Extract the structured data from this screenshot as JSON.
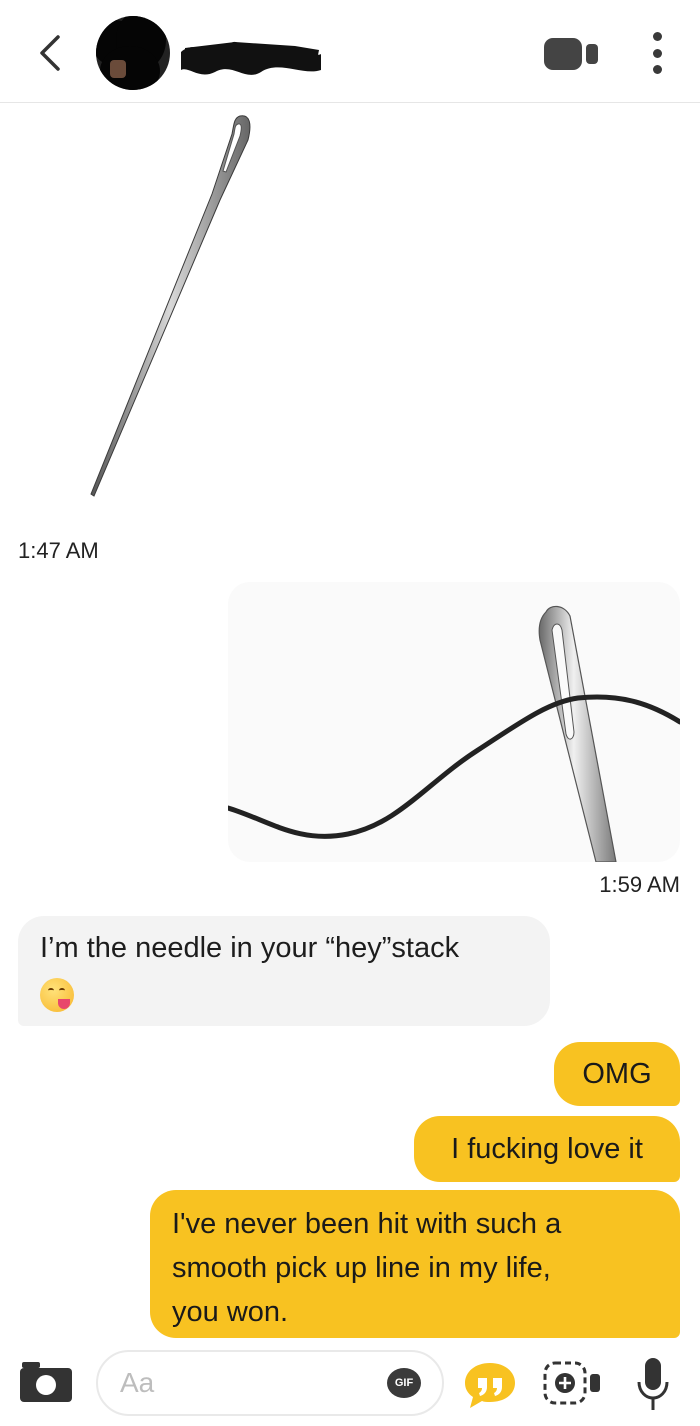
{
  "header": {
    "back_icon": "chevron-left-icon",
    "video_icon": "video-camera-icon",
    "more_icon": "more-vertical-icon"
  },
  "messages": [
    {
      "type": "image",
      "from": "them",
      "depicts": "needle"
    },
    {
      "type": "timestamp",
      "text": "1:47 AM"
    },
    {
      "type": "image",
      "from": "me",
      "depicts": "threaded-needle"
    },
    {
      "type": "timestamp",
      "text": "1:59 AM"
    },
    {
      "type": "text",
      "from": "them",
      "text": "I’m the needle in your “hey”stack",
      "emoji": "face-savoring-food"
    },
    {
      "type": "text",
      "from": "me",
      "text": "OMG"
    },
    {
      "type": "text",
      "from": "me",
      "text": "I fucking love it"
    },
    {
      "type": "text",
      "from": "me",
      "lines": [
        "I've never been hit with such a",
        "smooth pick up line in my life,",
        "you won."
      ]
    }
  ],
  "composer": {
    "placeholder": "Aa",
    "gif_label": "GIF"
  },
  "colors": {
    "outgoing_bubble": "#f8c221",
    "incoming_bubble": "#f3f3f3",
    "accent": "#f8c221"
  }
}
